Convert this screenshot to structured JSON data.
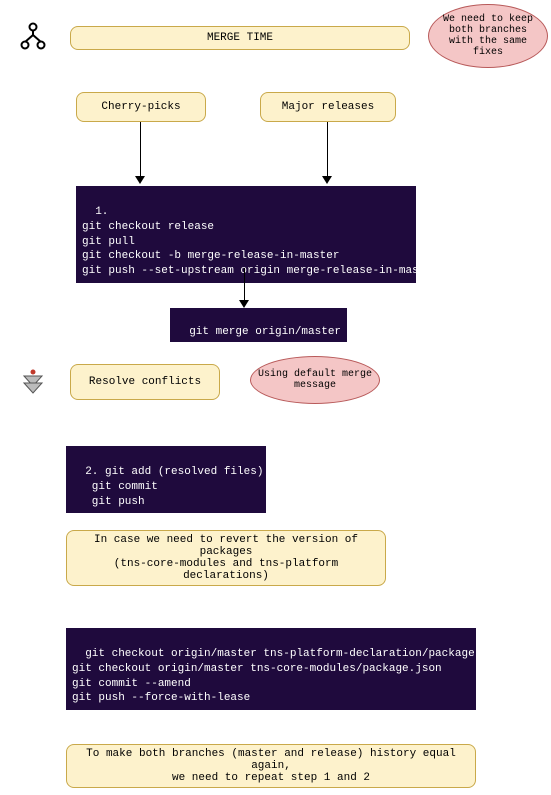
{
  "title": "MERGE TIME",
  "note_top": "We need to keep both branches with the same fixes",
  "branch_left": "Cherry-picks",
  "branch_right": "Major releases",
  "code1": "1.\ngit checkout release\ngit pull\ngit checkout -b merge-release-in-master\ngit push --set-upstream origin merge-release-in-master",
  "code_merge": "git merge origin/master",
  "resolve": "Resolve conflicts",
  "note_merge_msg": "Using default merge message",
  "code2": "2. git add (resolved files)\n   git commit\n   git push",
  "revert_note": "In case we need to revert the version of packages\n(tns-core-modules and tns-platform declarations)",
  "code3": "git checkout origin/master tns-platform-declaration/package.json\ngit checkout origin/master tns-core-modules/package.json\ngit commit --amend\ngit push --force-with-lease",
  "final_note": "To make both branches (master and release) history equal again,\nwe need to repeat step 1 and 2"
}
